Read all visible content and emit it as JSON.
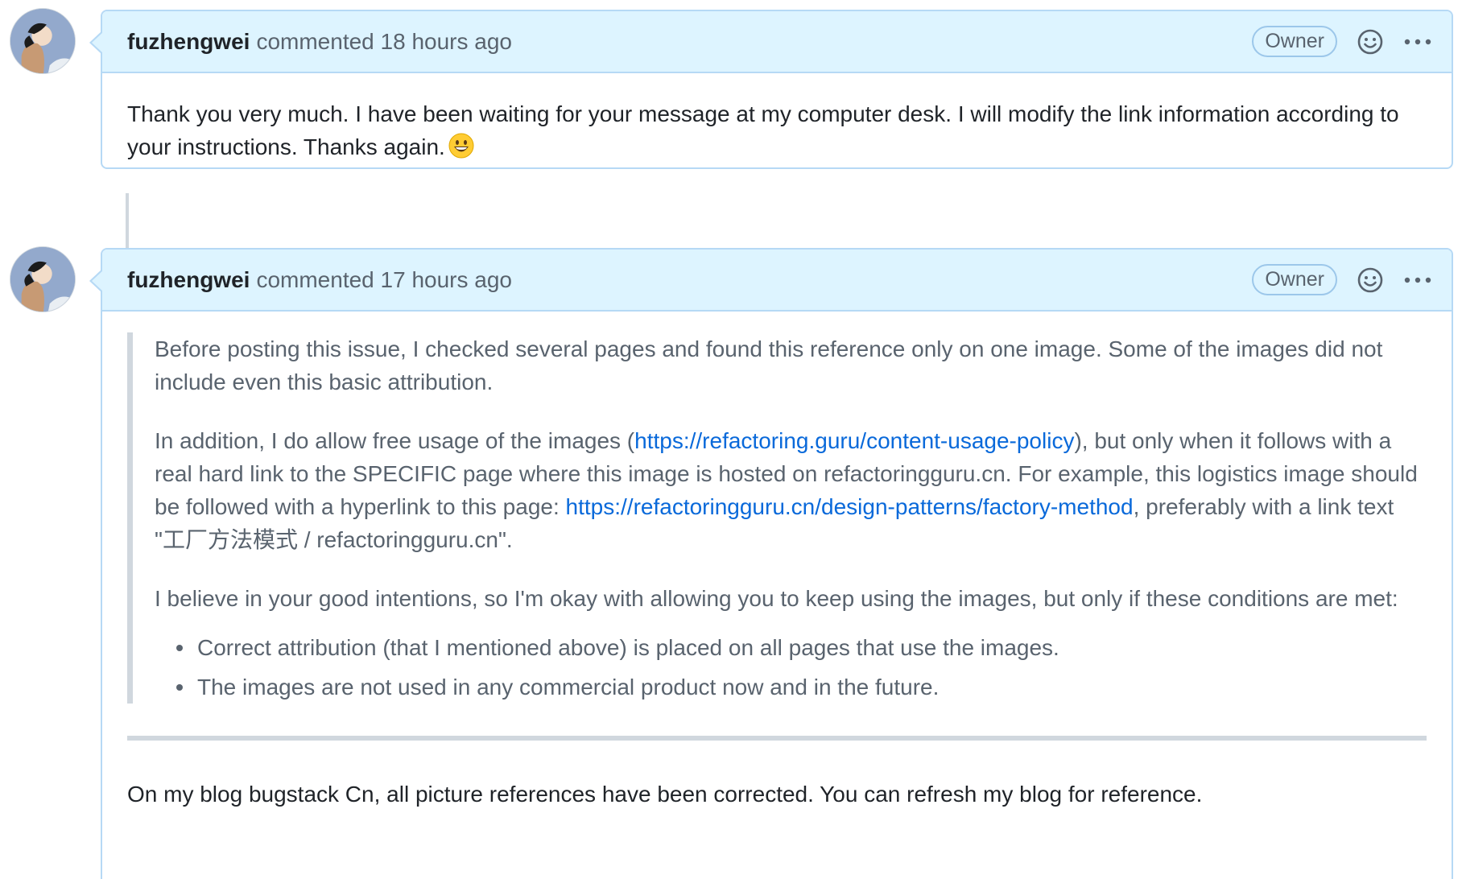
{
  "comments": [
    {
      "author": "fuzhengwei",
      "meta": "commented 18 hours ago",
      "badge": "Owner",
      "body": "Thank you very much. I have been waiting for your message at my computer desk. I will modify the link information according to your instructions. Thanks again."
    },
    {
      "author": "fuzhengwei",
      "meta": "commented 17 hours ago",
      "badge": "Owner",
      "quote": {
        "p1": "Before posting this issue, I checked several pages and found this reference only on one image. Some of the images did not include even this basic attribution.",
        "p2_before": "In addition, I do allow free usage of the images (",
        "p2_link1": "https://refactoring.guru/content-usage-policy",
        "p2_middle": "), but only when it follows with a real hard link to the SPECIFIC page where this image is hosted on refactoringguru.cn. For example, this logistics image should be followed with a hyperlink to this page: ",
        "p2_link2": "https://refactoringguru.cn/design-patterns/factory-method",
        "p2_after": ", preferably with a link text \"工厂方法模式 / refactoringguru.cn\".",
        "p3": "I believe in your good intentions, so I'm okay with allowing you to keep using the images, but only if these conditions are met:",
        "bullets": [
          "Correct attribution (that I mentioned above) is placed on all pages that use the images.",
          "The images are not used in any commercial product now and in the future."
        ]
      },
      "body_after": "On my blog bugstack Cn, all picture references have been corrected. You can refresh my blog for reference."
    }
  ],
  "colors": {
    "header_bg": "#ddf4ff",
    "border": "#b6d9f5",
    "link": "#0969da",
    "muted": "#59636e"
  }
}
